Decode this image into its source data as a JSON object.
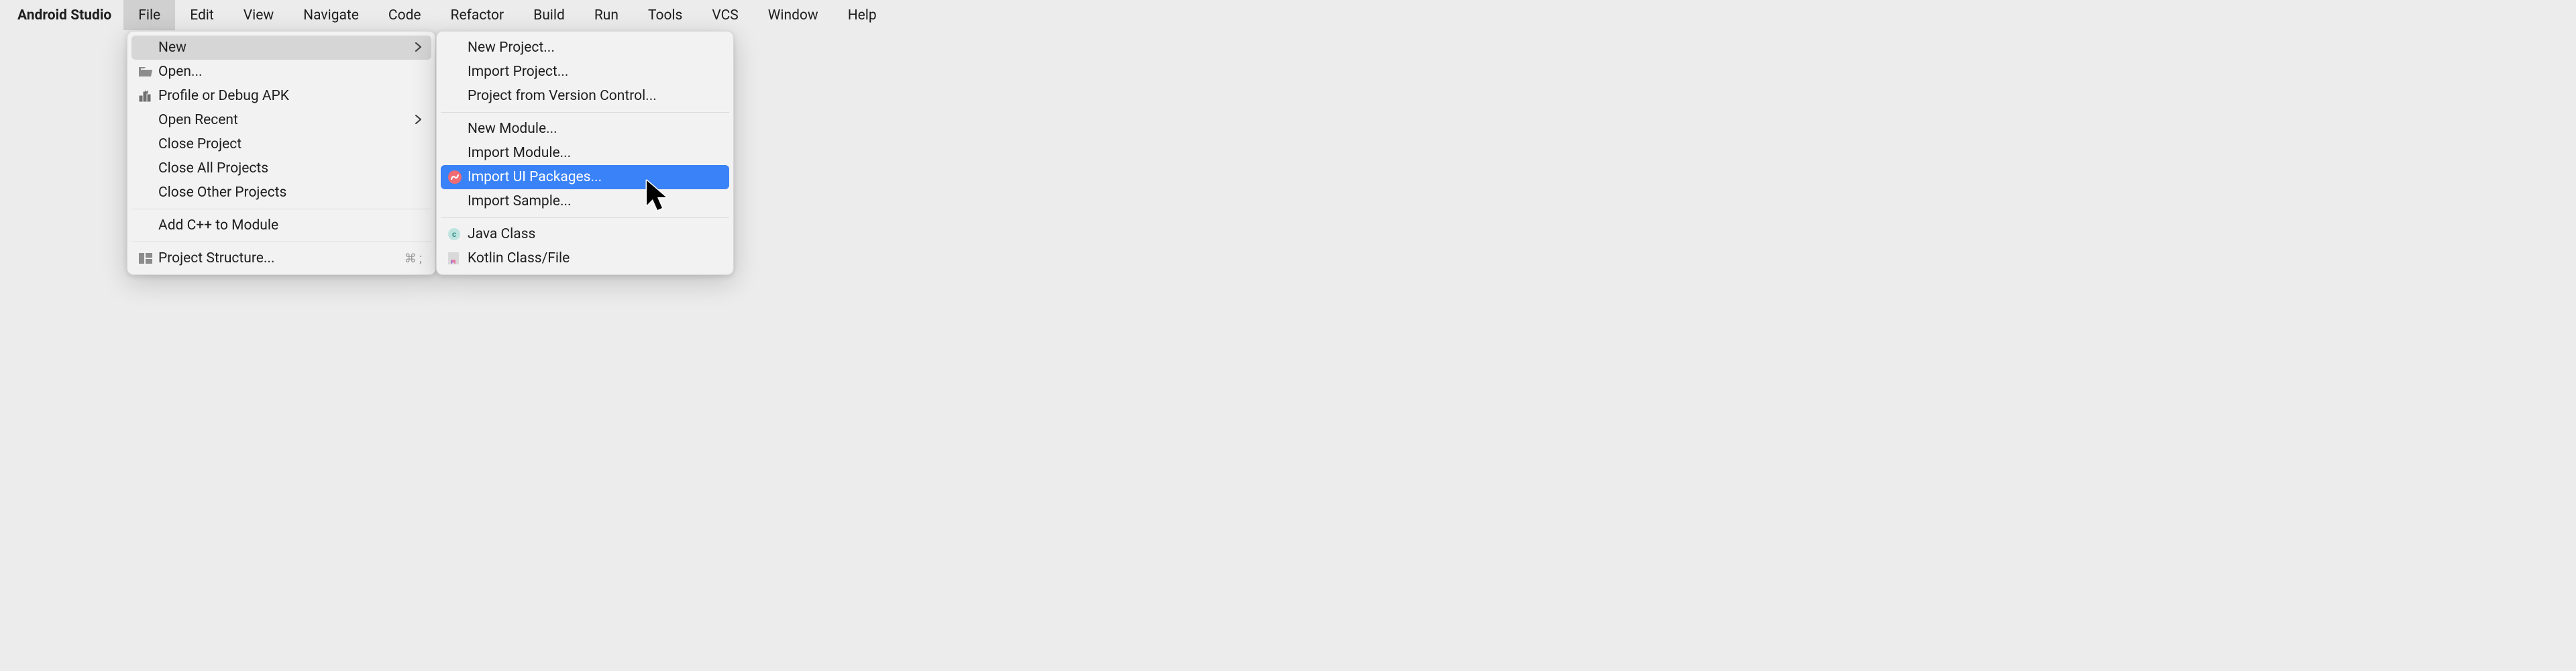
{
  "menubar": {
    "app_name": "Android Studio",
    "items": [
      {
        "label": "File",
        "active": true
      },
      {
        "label": "Edit"
      },
      {
        "label": "View"
      },
      {
        "label": "Navigate"
      },
      {
        "label": "Code"
      },
      {
        "label": "Refactor"
      },
      {
        "label": "Build"
      },
      {
        "label": "Run"
      },
      {
        "label": "Tools"
      },
      {
        "label": "VCS"
      },
      {
        "label": "Window"
      },
      {
        "label": "Help"
      }
    ]
  },
  "file_menu": {
    "new": "New",
    "open": "Open...",
    "profile_debug_apk": "Profile or Debug APK",
    "open_recent": "Open Recent",
    "close_project": "Close Project",
    "close_all_projects": "Close All Projects",
    "close_other_projects": "Close Other Projects",
    "add_cpp": "Add C++ to Module",
    "project_structure": "Project Structure...",
    "project_structure_shortcut": "⌘ ;"
  },
  "new_menu": {
    "new_project": "New Project...",
    "import_project": "Import Project...",
    "project_from_vcs": "Project from Version Control...",
    "new_module": "New Module...",
    "import_module": "Import Module...",
    "import_ui_packages": "Import UI Packages...",
    "import_sample": "Import Sample...",
    "java_class": "Java Class",
    "kotlin_class_file": "Kotlin Class/File"
  }
}
